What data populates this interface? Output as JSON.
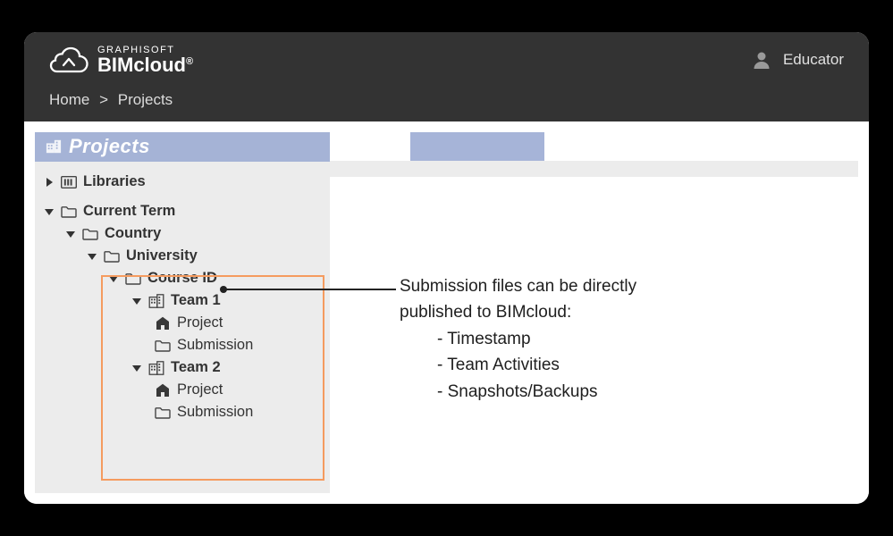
{
  "brand": {
    "company": "GRAPHISOFT",
    "product": "BIMcloud",
    "registered": "®"
  },
  "user": {
    "role": "Educator"
  },
  "breadcrumb": {
    "home": "Home",
    "sep": ">",
    "current": "Projects"
  },
  "sidebar": {
    "title": "Projects",
    "items": {
      "libraries": "Libraries",
      "current_term": "Current Term",
      "country": "Country",
      "university": "University",
      "course_id": "Course ID",
      "team1": "Team 1",
      "team1_project": "Project",
      "team1_submission": "Submission",
      "team2": "Team 2",
      "team2_project": "Project",
      "team2_submission": "Submission"
    }
  },
  "annotation": {
    "line1": "Submission files can be directly",
    "line2": "published to BIMcloud:",
    "bullets": {
      "b1": "- Timestamp",
      "b2": "- Team Activities",
      "b3": "- Snapshots/Backups"
    }
  }
}
